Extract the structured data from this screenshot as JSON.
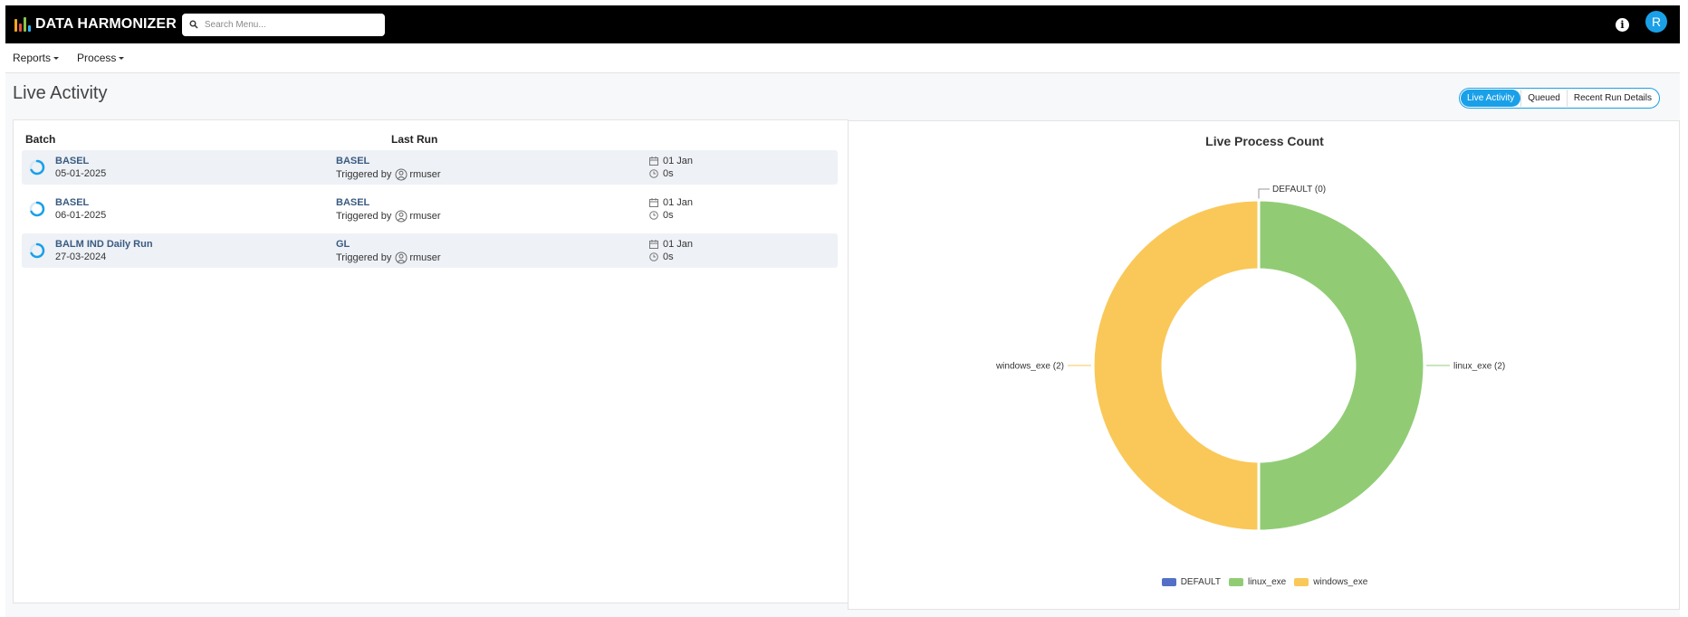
{
  "app": {
    "title": "DATA HARMONIZER"
  },
  "colors": {
    "accent": "#1aa0e8",
    "default": "#5470c6",
    "linux_exe": "#91cc75",
    "windows_exe": "#fac858"
  },
  "search": {
    "placeholder": "Search Menu..."
  },
  "header": {
    "info_icon": "info-icon",
    "avatar_initial": "R"
  },
  "menu": [
    {
      "label": "Reports"
    },
    {
      "label": "Process"
    }
  ],
  "page": {
    "title": "Live Activity"
  },
  "views": [
    {
      "label": "Live Activity",
      "active": true
    },
    {
      "label": "Queued",
      "active": false
    },
    {
      "label": "Recent Run Details",
      "active": false
    }
  ],
  "table": {
    "headers": {
      "batch": "Batch",
      "last_run": "Last Run"
    },
    "triggered_prefix": "Triggered by",
    "rows": [
      {
        "batch": "BASEL",
        "date": "05-01-2025",
        "run": "BASEL",
        "user": "rmuser",
        "day": "01 Jan",
        "duration": "0s",
        "shaded": true
      },
      {
        "batch": "BASEL",
        "date": "06-01-2025",
        "run": "BASEL",
        "user": "rmuser",
        "day": "01 Jan",
        "duration": "0s",
        "shaded": false
      },
      {
        "batch": "BALM IND Daily Run",
        "date": "27-03-2024",
        "run": "GL",
        "user": "rmuser",
        "day": "01 Jan",
        "duration": "0s",
        "shaded": true
      }
    ]
  },
  "chart_data": {
    "type": "pie",
    "title": "Live Process Count",
    "style": "donut",
    "slices": [
      {
        "name": "DEFAULT",
        "value": 0,
        "label": "DEFAULT (0)"
      },
      {
        "name": "linux_exe",
        "value": 2,
        "label": "linux_exe (2)"
      },
      {
        "name": "windows_exe",
        "value": 2,
        "label": "windows_exe (2)"
      }
    ],
    "legend": [
      "DEFAULT",
      "linux_exe",
      "windows_exe"
    ],
    "legend_position": "bottom"
  }
}
